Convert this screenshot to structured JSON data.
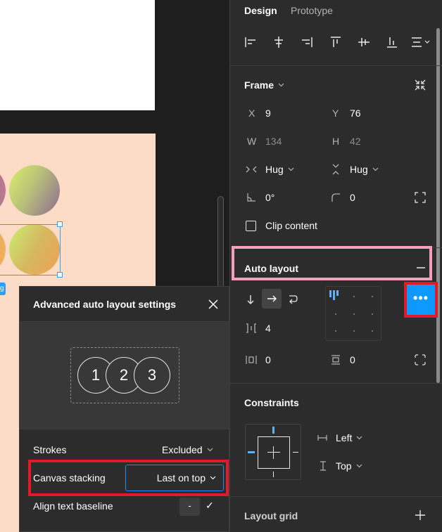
{
  "canvas": {
    "selection_tag": "g"
  },
  "popup": {
    "title": "Advanced auto layout settings",
    "preview_items": [
      "1",
      "2",
      "3"
    ],
    "strokes_label": "Strokes",
    "strokes_value": "Excluded",
    "stacking_label": "Canvas stacking",
    "stacking_value": "Last on top",
    "baseline_label": "Align text baseline",
    "baseline_minus": "-",
    "baseline_check": "✓"
  },
  "panel": {
    "tabs": {
      "design": "Design",
      "prototype": "Prototype"
    },
    "frame": {
      "title": "Frame",
      "x_label": "X",
      "x_value": "9",
      "y_label": "Y",
      "y_value": "76",
      "w_label": "W",
      "w_value": "134",
      "h_label": "H",
      "h_value": "42",
      "hug_h": "Hug",
      "hug_v": "Hug",
      "rotation": "0°",
      "radius": "0",
      "clip_label": "Clip content"
    },
    "auto_layout": {
      "title": "Auto layout",
      "gap": "4",
      "padding_h": "0",
      "padding_v": "0",
      "more_label": "•••"
    },
    "constraints": {
      "title": "Constraints",
      "horizontal": "Left",
      "vertical": "Top"
    },
    "layout_grid": {
      "title": "Layout grid",
      "add": "+"
    }
  },
  "colors": {
    "accent": "#0d99ff",
    "panel_bg": "#2c2c2c",
    "canvas_bg": "#1e1e1e",
    "peach_frame": "#fcdcc7",
    "highlight_red": "#e11a2a",
    "highlight_pink": "#f5a0b8"
  }
}
